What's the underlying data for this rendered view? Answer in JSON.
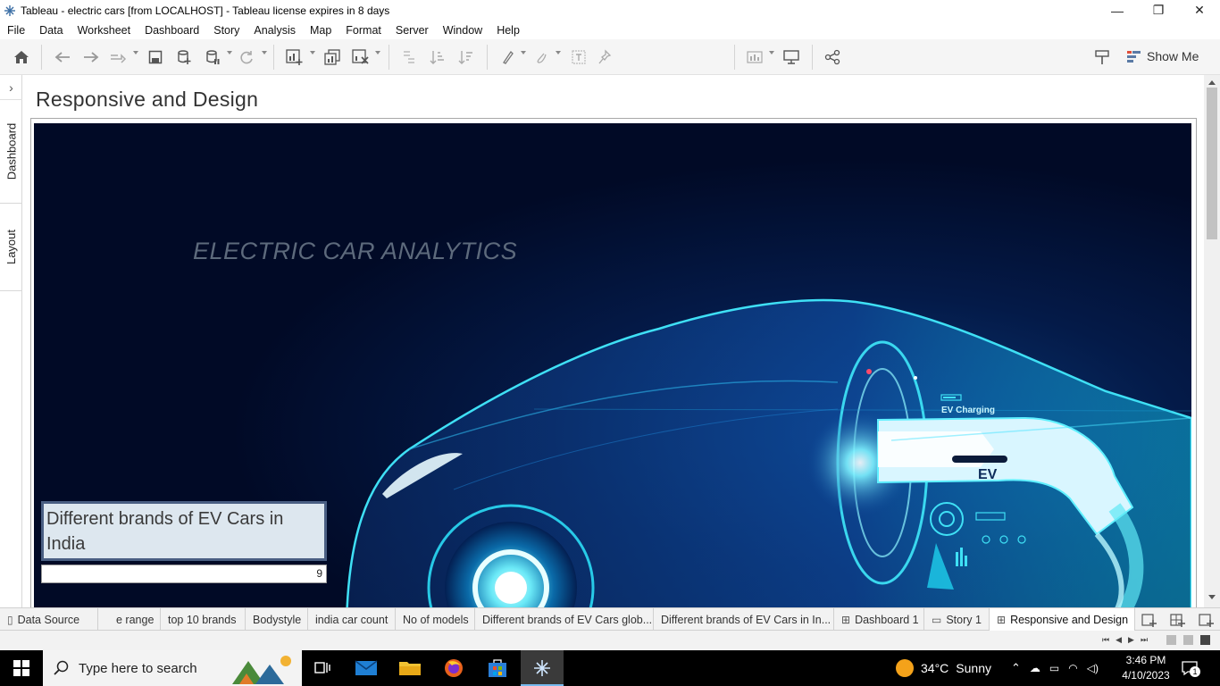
{
  "window": {
    "title": "Tableau - electric cars [from LOCALHOST] - Tableau license expires in 8 days",
    "minimize": "—",
    "maximize": "❐",
    "close": "✕"
  },
  "menu": [
    "File",
    "Data",
    "Worksheet",
    "Dashboard",
    "Story",
    "Analysis",
    "Map",
    "Format",
    "Server",
    "Window",
    "Help"
  ],
  "toolbar": {
    "show_me_label": "Show Me",
    "icons": [
      "home-icon",
      "undo-icon",
      "redo-icon",
      "replay-icon",
      "save-icon",
      "new-data-source-icon",
      "pause-updates-icon",
      "refresh-icon",
      "new-worksheet-icon",
      "duplicate-icon",
      "clear-sheet-icon",
      "swap-icon",
      "sort-ascending-icon",
      "sort-descending-icon",
      "highlight-icon",
      "group-icon",
      "labels-icon",
      "pin-icon",
      "fit-icon",
      "presentation-icon",
      "share-icon",
      "format-painter-icon",
      "show-me-icon"
    ]
  },
  "side_panel": {
    "tabs": [
      "Dashboard",
      "Layout"
    ]
  },
  "dashboard": {
    "title": "Responsive and Design",
    "hero_heading": "ELECTRIC CAR ANALYTICS",
    "hero_badge": "EV",
    "hero_charging": "EV Charging",
    "kpi": {
      "label": "Different brands of EV Cars in India",
      "value": "9"
    },
    "colors": {
      "background": "#010a26",
      "glow": "#19d6f2",
      "kpi_fill": "#dde7ef",
      "kpi_border": "#4a5f83"
    }
  },
  "sheet_tabs": [
    {
      "label": "Data Source",
      "icon": "database-icon",
      "active": false
    },
    {
      "label": "e range",
      "icon": "",
      "active": false
    },
    {
      "label": "top 10 brands",
      "icon": "",
      "active": false
    },
    {
      "label": "Bodystyle",
      "icon": "",
      "active": false
    },
    {
      "label": "india car count",
      "icon": "",
      "active": false
    },
    {
      "label": "No of models",
      "icon": "",
      "active": false
    },
    {
      "label": "Different brands of EV Cars glob...",
      "icon": "",
      "active": false
    },
    {
      "label": "Different brands of EV Cars in In...",
      "icon": "",
      "active": false
    },
    {
      "label": "Dashboard 1",
      "icon": "dashboard-icon",
      "active": false
    },
    {
      "label": "Story 1",
      "icon": "story-icon",
      "active": false
    },
    {
      "label": "Responsive and Design",
      "icon": "dashboard-icon",
      "active": true
    }
  ],
  "taskbar": {
    "search_placeholder": "Type here to search",
    "weather_temp": "34°C",
    "weather_desc": "Sunny",
    "time": "3:46 PM",
    "date": "4/10/2023",
    "notification_count": "1"
  }
}
